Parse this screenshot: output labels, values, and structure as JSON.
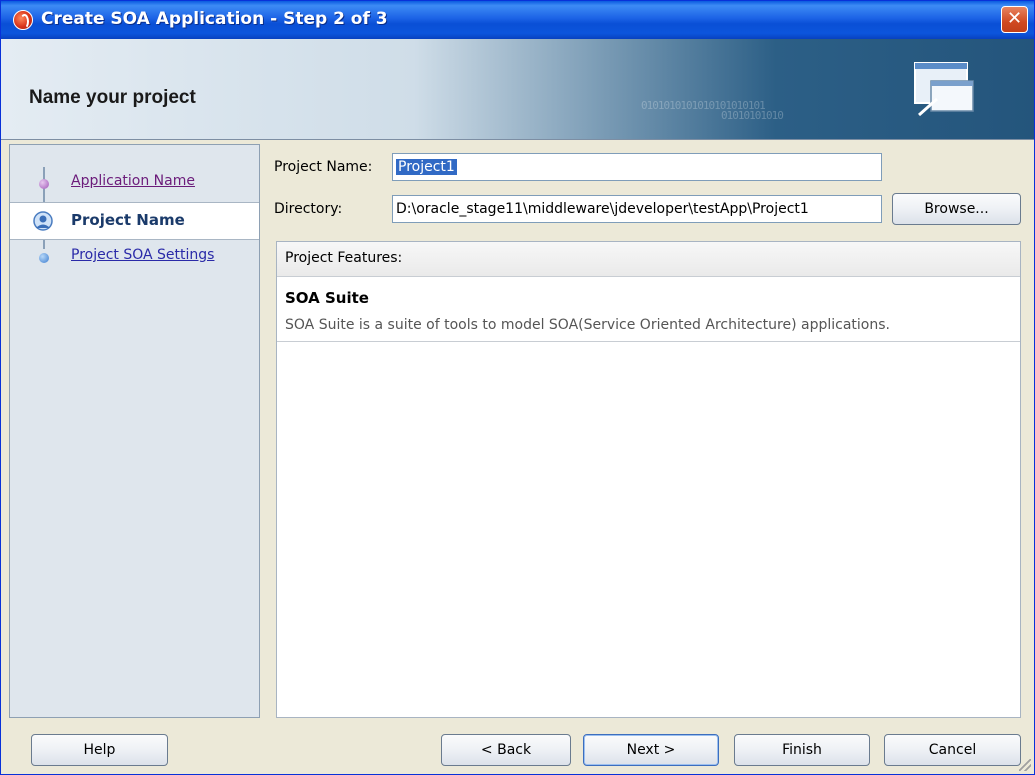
{
  "window": {
    "title": "Create SOA Application - Step 2 of 3",
    "close_label": "✕"
  },
  "header": {
    "title": "Name your project",
    "binary_text": "0101010101010101010101",
    "binary_text2": "01010101010"
  },
  "nav": {
    "items": [
      {
        "label": "Application Name",
        "state": "visited"
      },
      {
        "label": "Project Name",
        "state": "current"
      },
      {
        "label": "Project SOA Settings",
        "state": "pending"
      }
    ]
  },
  "form": {
    "project_name_label": "Project Name:",
    "project_name_value": "Project1",
    "directory_label": "Directory:",
    "directory_value": "D:\\oracle_stage11\\middleware\\jdeveloper\\testApp\\Project1",
    "browse_label": "Browse..."
  },
  "features": {
    "header": "Project Features:",
    "items": [
      {
        "name": "SOA Suite",
        "description": "SOA Suite is a suite of tools to model SOA(Service Oriented Architecture) applications."
      }
    ]
  },
  "buttons": {
    "help": "Help",
    "back": "< Back",
    "next": "Next >",
    "finish": "Finish",
    "cancel": "Cancel"
  },
  "colors": {
    "title_bar": "#0a4fd6",
    "selection": "#316ac5",
    "nav_background": "#dfe6ed"
  }
}
